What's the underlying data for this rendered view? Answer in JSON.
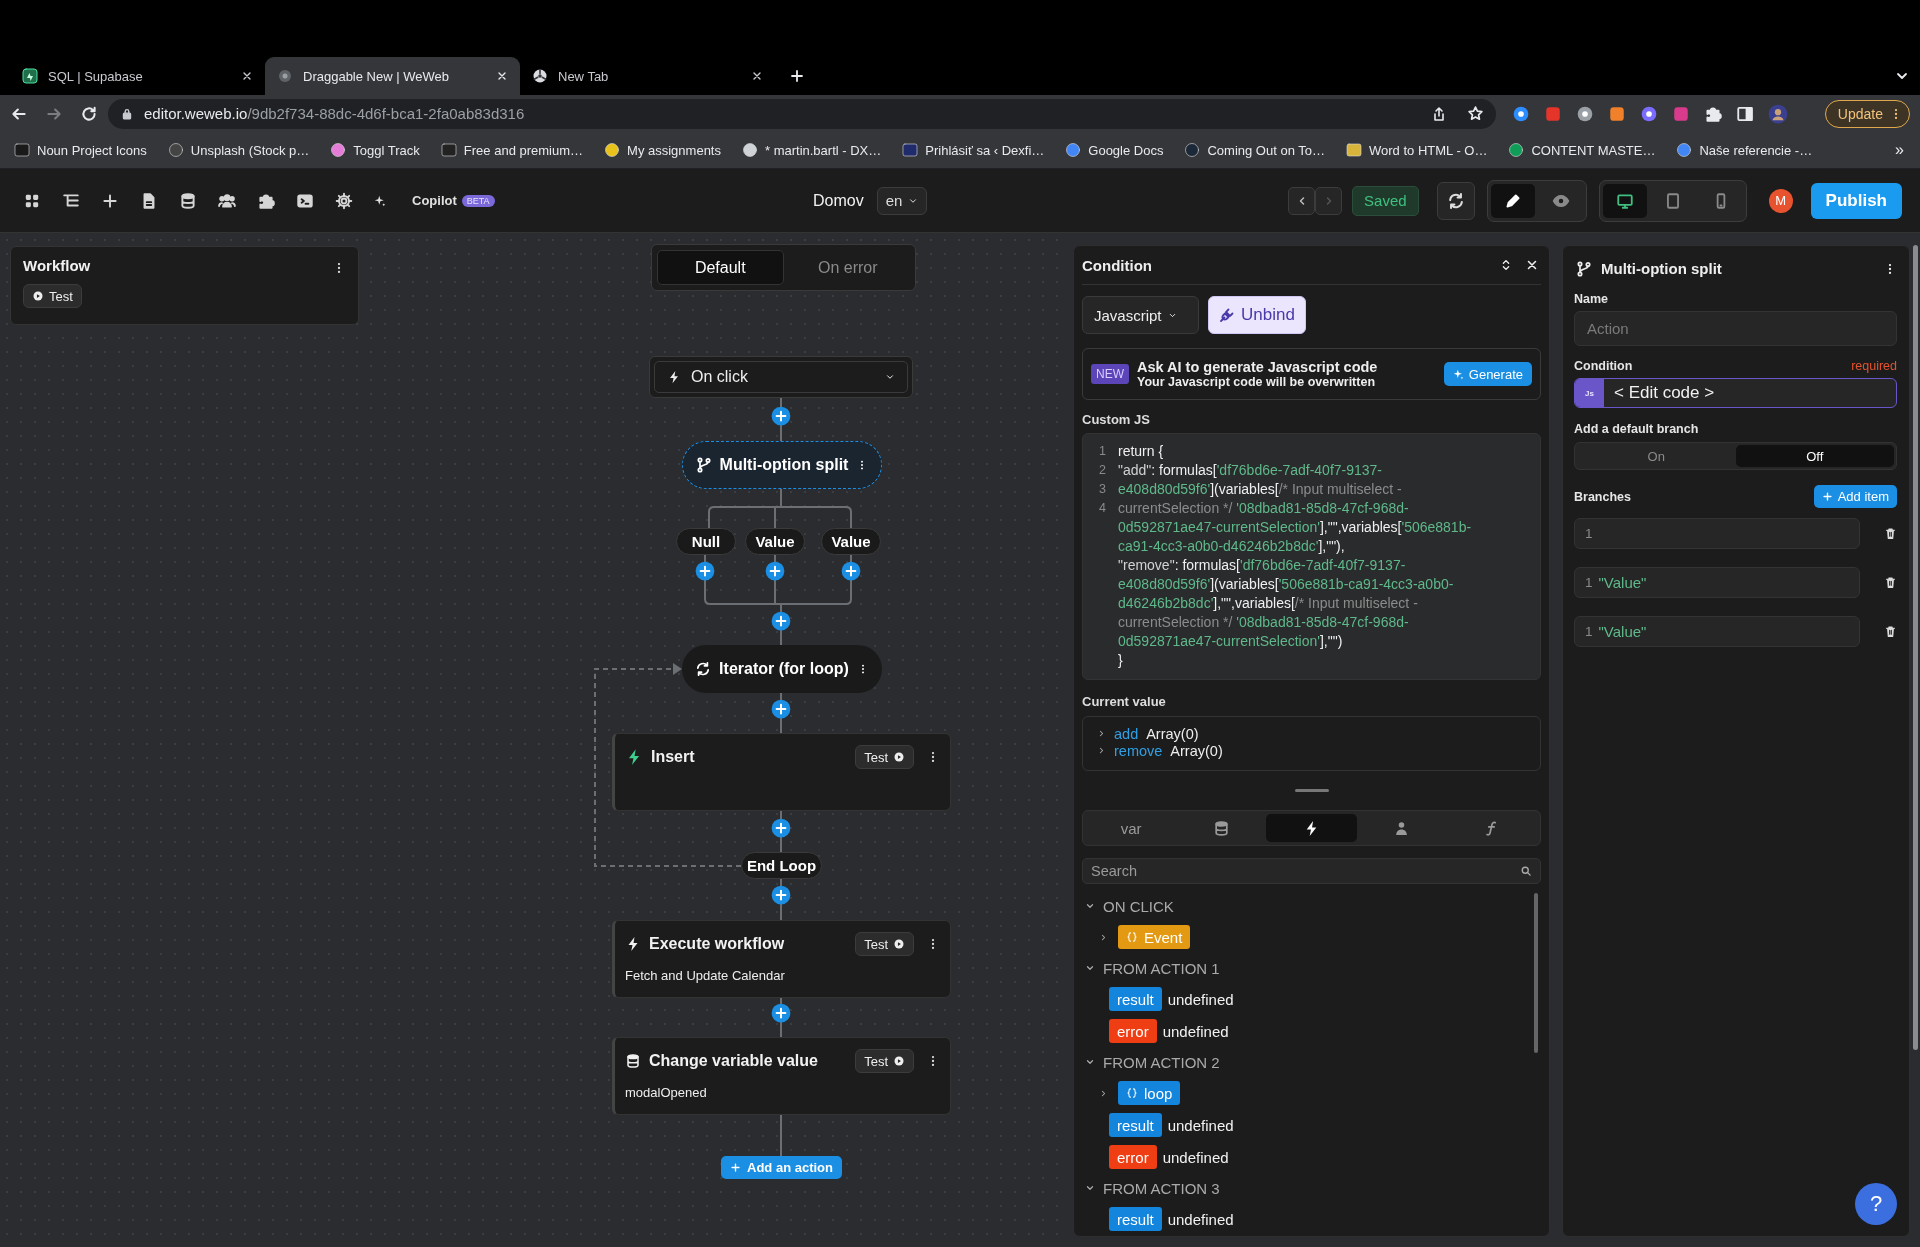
{
  "browser": {
    "tabs": [
      {
        "title": "SQL | Supabase",
        "selected": false,
        "kind": "supabase"
      },
      {
        "title": "Draggable New | WeWeb",
        "selected": true,
        "kind": "weweb"
      },
      {
        "title": "New Tab",
        "selected": false,
        "kind": "chrome"
      }
    ],
    "url": "editor.weweb.io/9db2f734-88dc-4d6f-bca1-2fa0ab83d316",
    "bookmarks": [
      "Noun Project Icons",
      "Unsplash (Stock p…",
      "Toggl Track",
      "Free and premium…",
      "My assignments",
      "* martin.bartl - DX…",
      "Prihlásiť sa ‹ Dexfi…",
      "Google Docs",
      "Coming Out on To…",
      "Word to HTML - O…",
      "CONTENT MASTE…",
      "Naše referencie -…"
    ],
    "more_bookmarks": "»",
    "update": "Update"
  },
  "toolbar": {
    "copilot": "Copilot",
    "beta": "BETA",
    "page": "Domov",
    "language": "en",
    "saved": "Saved",
    "modes": [
      {
        "kind": "edit",
        "selected": true
      },
      {
        "kind": "preview",
        "selected": false
      }
    ],
    "devices": [
      {
        "kind": "desktop",
        "selected": true
      },
      {
        "kind": "tablet",
        "selected": false
      },
      {
        "kind": "mobile",
        "selected": false
      }
    ],
    "avatar": "M",
    "publish": "Publish"
  },
  "canvas": {
    "workflow": {
      "title": "Workflow",
      "test": "Test"
    },
    "modes": [
      {
        "label": "Default",
        "selected": true
      },
      {
        "label": "On error",
        "selected": false
      }
    ],
    "trigger": "On click",
    "split": {
      "title": "Multi-option split",
      "selected": true,
      "branches": [
        "Null",
        "Value",
        "Value"
      ]
    },
    "iterator": {
      "title": "Iterator (for loop)",
      "end": "End Loop"
    },
    "actions": [
      {
        "kind": "insert",
        "title": "Insert",
        "test": "Test"
      },
      {
        "kind": "workflow",
        "title": "Execute workflow",
        "subtitle": "Fetch and Update Calendar",
        "test": "Test"
      },
      {
        "kind": "variable",
        "title": "Change variable value",
        "subtitle": "modalOpened",
        "test": "Test"
      }
    ],
    "add_action": "Add an action"
  },
  "condition": {
    "title": "Condition",
    "language": "Javascript",
    "unbind": "Unbind",
    "ai": {
      "badge": "NEW",
      "title": "Ask AI to generate Javascript code",
      "subtitle": "Your Javascript code will be overwritten",
      "button": "Generate"
    },
    "code_label": "Custom JS",
    "code_lines": [
      {
        "number": "1",
        "tokens": [
          {
            "kind": "plain",
            "text": "return {"
          }
        ]
      },
      {
        "number": "2",
        "tokens": [
          {
            "kind": "key",
            "text": "\"add\""
          },
          {
            "kind": "plain",
            "text": ": formulas["
          },
          {
            "kind": "string",
            "text": "'df76bd6e-7adf-40f7-9137-"
          }
        ]
      },
      {
        "number": "3",
        "tokens": [
          {
            "kind": "string",
            "text": "e408d80d59f6'"
          },
          {
            "kind": "plain",
            "text": "](variables["
          },
          {
            "kind": "comment",
            "text": "/* Input multiselect -"
          }
        ]
      },
      {
        "number": "4",
        "tokens": [
          {
            "kind": "comment",
            "text": "currentSelection */"
          },
          {
            "kind": "string",
            "text": " '08dbad81-85d8-47cf-968d-"
          }
        ]
      },
      {
        "tokens": [
          {
            "kind": "string",
            "text": "0d592871ae47-currentSelection'"
          },
          {
            "kind": "plain",
            "text": "],\"\",variables["
          },
          {
            "kind": "string",
            "text": "'506e881b-"
          }
        ]
      },
      {
        "tokens": [
          {
            "kind": "string",
            "text": "ca91-4cc3-a0b0-d46246b2b8dc'"
          },
          {
            "kind": "plain",
            "text": "],\"\"),"
          }
        ]
      },
      {
        "tokens": [
          {
            "kind": "key",
            "text": "\"remove\""
          },
          {
            "kind": "plain",
            "text": ": formulas["
          },
          {
            "kind": "string",
            "text": "'df76bd6e-7adf-40f7-9137-"
          }
        ]
      },
      {
        "tokens": [
          {
            "kind": "string",
            "text": "e408d80d59f6'"
          },
          {
            "kind": "plain",
            "text": "](variables["
          },
          {
            "kind": "string",
            "text": "'506e881b-ca91-4cc3-a0b0-"
          }
        ]
      },
      {
        "tokens": [
          {
            "kind": "string",
            "text": "d46246b2b8dc'"
          },
          {
            "kind": "plain",
            "text": "],\"\",variables["
          },
          {
            "kind": "comment",
            "text": "/* Input multiselect -"
          }
        ]
      },
      {
        "tokens": [
          {
            "kind": "comment",
            "text": "currentSelection */"
          },
          {
            "kind": "string",
            "text": " '08dbad81-85d8-47cf-968d-"
          }
        ]
      },
      {
        "tokens": [
          {
            "kind": "string",
            "text": "0d592871ae47-currentSelection'"
          },
          {
            "kind": "plain",
            "text": "],\"\")"
          }
        ]
      },
      {
        "tokens": [
          {
            "kind": "plain",
            "text": "}"
          }
        ]
      }
    ],
    "current_value_label": "Current value",
    "current_value": [
      {
        "key": "add",
        "value": "Array(0)"
      },
      {
        "key": "remove",
        "value": "Array(0)"
      }
    ]
  },
  "variables": {
    "tabs": [
      {
        "kind": "text",
        "label": "var",
        "selected": false
      },
      {
        "kind": "database",
        "selected": false
      },
      {
        "kind": "workflow",
        "selected": true
      },
      {
        "kind": "user",
        "selected": false
      },
      {
        "kind": "formula",
        "selected": false
      }
    ],
    "search_placeholder": "Search",
    "groups": [
      {
        "title": "ON CLICK",
        "expanded": true,
        "items": [
          {
            "kind": "object",
            "label": "Event",
            "expanded": false,
            "color": "#e39a12"
          }
        ]
      },
      {
        "title": "FROM ACTION 1",
        "expanded": true,
        "items": [
          {
            "kind": "value",
            "label": "result",
            "value": "undefined",
            "color": "#1485dc"
          },
          {
            "kind": "value",
            "label": "error",
            "value": "undefined",
            "color": "#f03e14"
          }
        ]
      },
      {
        "title": "FROM ACTION 2",
        "expanded": true,
        "items": [
          {
            "kind": "object",
            "label": "loop",
            "expanded": false,
            "color": "#1485dc"
          },
          {
            "kind": "value",
            "label": "result",
            "value": "undefined",
            "color": "#1485dc"
          },
          {
            "kind": "value",
            "label": "error",
            "value": "undefined",
            "color": "#f03e14"
          }
        ]
      },
      {
        "title": "FROM ACTION 3",
        "expanded": true,
        "items": [
          {
            "kind": "value",
            "label": "result",
            "value": "undefined",
            "color": "#1485dc"
          }
        ]
      }
    ]
  },
  "properties": {
    "title": "Multi-option split",
    "name_label": "Name",
    "name_placeholder": "Action",
    "condition_label": "Condition",
    "required": "required",
    "js_badge": "Js",
    "edit_code": "< Edit code >",
    "default_branch_label": "Add a default branch",
    "default_branch_options": [
      {
        "label": "On",
        "selected": false
      },
      {
        "label": "Off",
        "selected": true
      }
    ],
    "branches_label": "Branches",
    "add_item": "Add item",
    "branches": [
      {
        "line": "1"
      },
      {
        "line": "1",
        "value": "\"Value\""
      },
      {
        "line": "1",
        "value": "\"Value\""
      }
    ]
  },
  "help_button": "?"
}
